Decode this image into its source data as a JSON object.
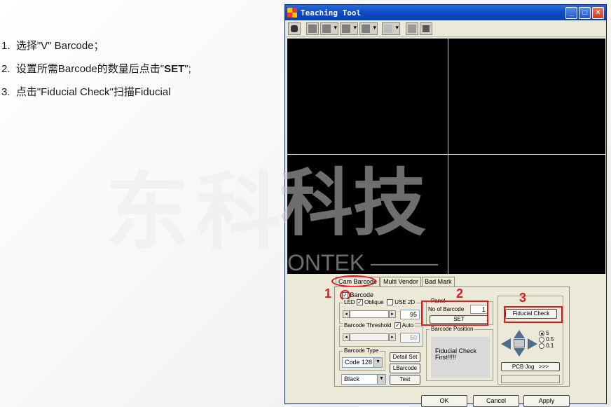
{
  "instructions": [
    {
      "num": "1.",
      "pre": "选择\"V\" Barcode；",
      "bold": "",
      "post": ""
    },
    {
      "num": "2.",
      "pre": "设置所需Barcode的数量后点击\"",
      "bold": "SET",
      "post": "\";"
    },
    {
      "num": "3.",
      "pre": "点击\"Fiducial Check\"扫描Fiducial",
      "bold": "",
      "post": ""
    }
  ],
  "watermark": {
    "main": "东科技",
    "camera": "科技",
    "brand": "ONTEK ———"
  },
  "window": {
    "title": "Teaching Tool",
    "minimize": "_",
    "maximize": "□",
    "close": "✕"
  },
  "tabs": [
    "Cam Barcode",
    "Multi Vendor",
    "Bad Mark"
  ],
  "barcode": {
    "enable_label": "Barcode",
    "led_label": "LED",
    "oblique_label": "Oblique",
    "use2d_label": "USE 2D",
    "led_value": "95",
    "threshold_label": "Barcode Threshold",
    "auto_label": "Auto",
    "threshold_value": "50",
    "type_group": "Barcode Type",
    "type_value": "Code 128",
    "color_value": "Black",
    "detail_set": "Detail Set",
    "lbarcode": "LBarcode",
    "test": "Test"
  },
  "panel": {
    "group": "Panel",
    "count_label": "No of Barcode",
    "count_value": "1",
    "set_button": "SET",
    "position_group": "Barcode Position",
    "position_msg": "Fiducial Check First!!!!!"
  },
  "fiducial": {
    "button": "Fiducial Check",
    "steps": [
      "5",
      "0.5",
      "0.1"
    ],
    "jog": "PCB Jog",
    "jog_more": ">>>"
  },
  "dialog_buttons": {
    "ok": "OK",
    "cancel": "Cancel",
    "apply": "Apply"
  },
  "annotations": {
    "n1": "1",
    "n2": "2",
    "n3": "3"
  },
  "colors": {
    "annotation": "#e0191a",
    "title_bar": "#0c4cc6"
  }
}
